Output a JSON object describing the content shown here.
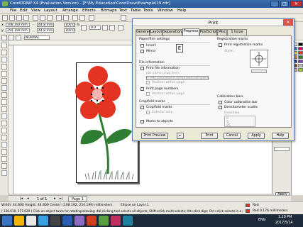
{
  "window": {
    "title": "CorelDRAW X4 (Evaluation Version) - [F:\\My Education\\CorelDraw\\Example\\19.cdr]",
    "min": "_",
    "max": "□",
    "close": "✕"
  },
  "menu": [
    "File",
    "Edit",
    "View",
    "Layout",
    "Arrange",
    "Effects",
    "Bitmaps",
    "Text",
    "Table",
    "Tools",
    "Window",
    "Help"
  ],
  "props": {
    "x": "108.192 mm",
    "y": "254.199 mm",
    "w": "44.8 mm",
    "h": "44.8 mm",
    "scale_w": "100.0",
    "scale_h": "100.0",
    "pct": "%",
    "angle": "0.0",
    "outline": "NORMAL"
  },
  "dialog": {
    "title": "Print",
    "close": "✕",
    "tabs": [
      "General",
      "Layout",
      "Separations",
      "Prepress",
      "PostScript",
      "Misc",
      "1 Issue"
    ],
    "active_tab": "Prepress",
    "paper_group": "Paper/film settings",
    "invert": "Invert",
    "mirror": "Mirror",
    "file_info_group": "File information",
    "print_file_info": "Print file information",
    "job_name_label": "Job name (slug line):",
    "job_name_value": "F:\\My Education\\CorelDraw\\Example\\19",
    "position_within_page": "Position within page",
    "print_page_numbers": "Print page numbers",
    "position_within_page2": "Position within page",
    "crop_group": "Crop/fold marks",
    "crop_fold_marks": "Crop/fold marks",
    "exterior_only": "Exterior only",
    "marks_to_objects": "Marks to objects",
    "registration_group": "Registration marks",
    "print_registration": "Print registration marks",
    "style_label": "Style:",
    "calibration_group": "Calibration bars",
    "color_calibration": "Color calibration bar",
    "densitometer": "Densitometer scales",
    "densities_label": "Densities",
    "densities": [
      "0",
      "5",
      "25",
      "50",
      "75",
      "95",
      "100"
    ],
    "buttons": {
      "print_preview": "Print Preview",
      "print": "Print",
      "cancel": "Cancel",
      "apply": "Apply",
      "help": "Help"
    }
  },
  "pagebar": {
    "page_of": "1 of 1",
    "page_tab": "Page 1"
  },
  "status": {
    "line1": "Width: 44.800  Height: 44.800  Center: (108.192, 254.199)  millimeters",
    "line1_right": "Ellipse on Layer 1",
    "line2": "( 138.610, 177.629 )  Click an object twice for rotating/skewing; dbl-clicking tool selects all objects; Shift+click multi-selects; Alt+click digs; Ctrl+click selects in a group",
    "fill_label": "Red",
    "outline_label": "Red  0.176 millimeters"
  },
  "taskbar": {
    "lang": "ENG",
    "time": "1:29 PM",
    "date": "2017/5/14"
  },
  "colors": {
    "title_blue": "#2b5a96",
    "petal_red": "#e53322",
    "flower_center": "#f4b7b4",
    "stem_green": "#2e7d32",
    "close_red": "#d9534f"
  }
}
